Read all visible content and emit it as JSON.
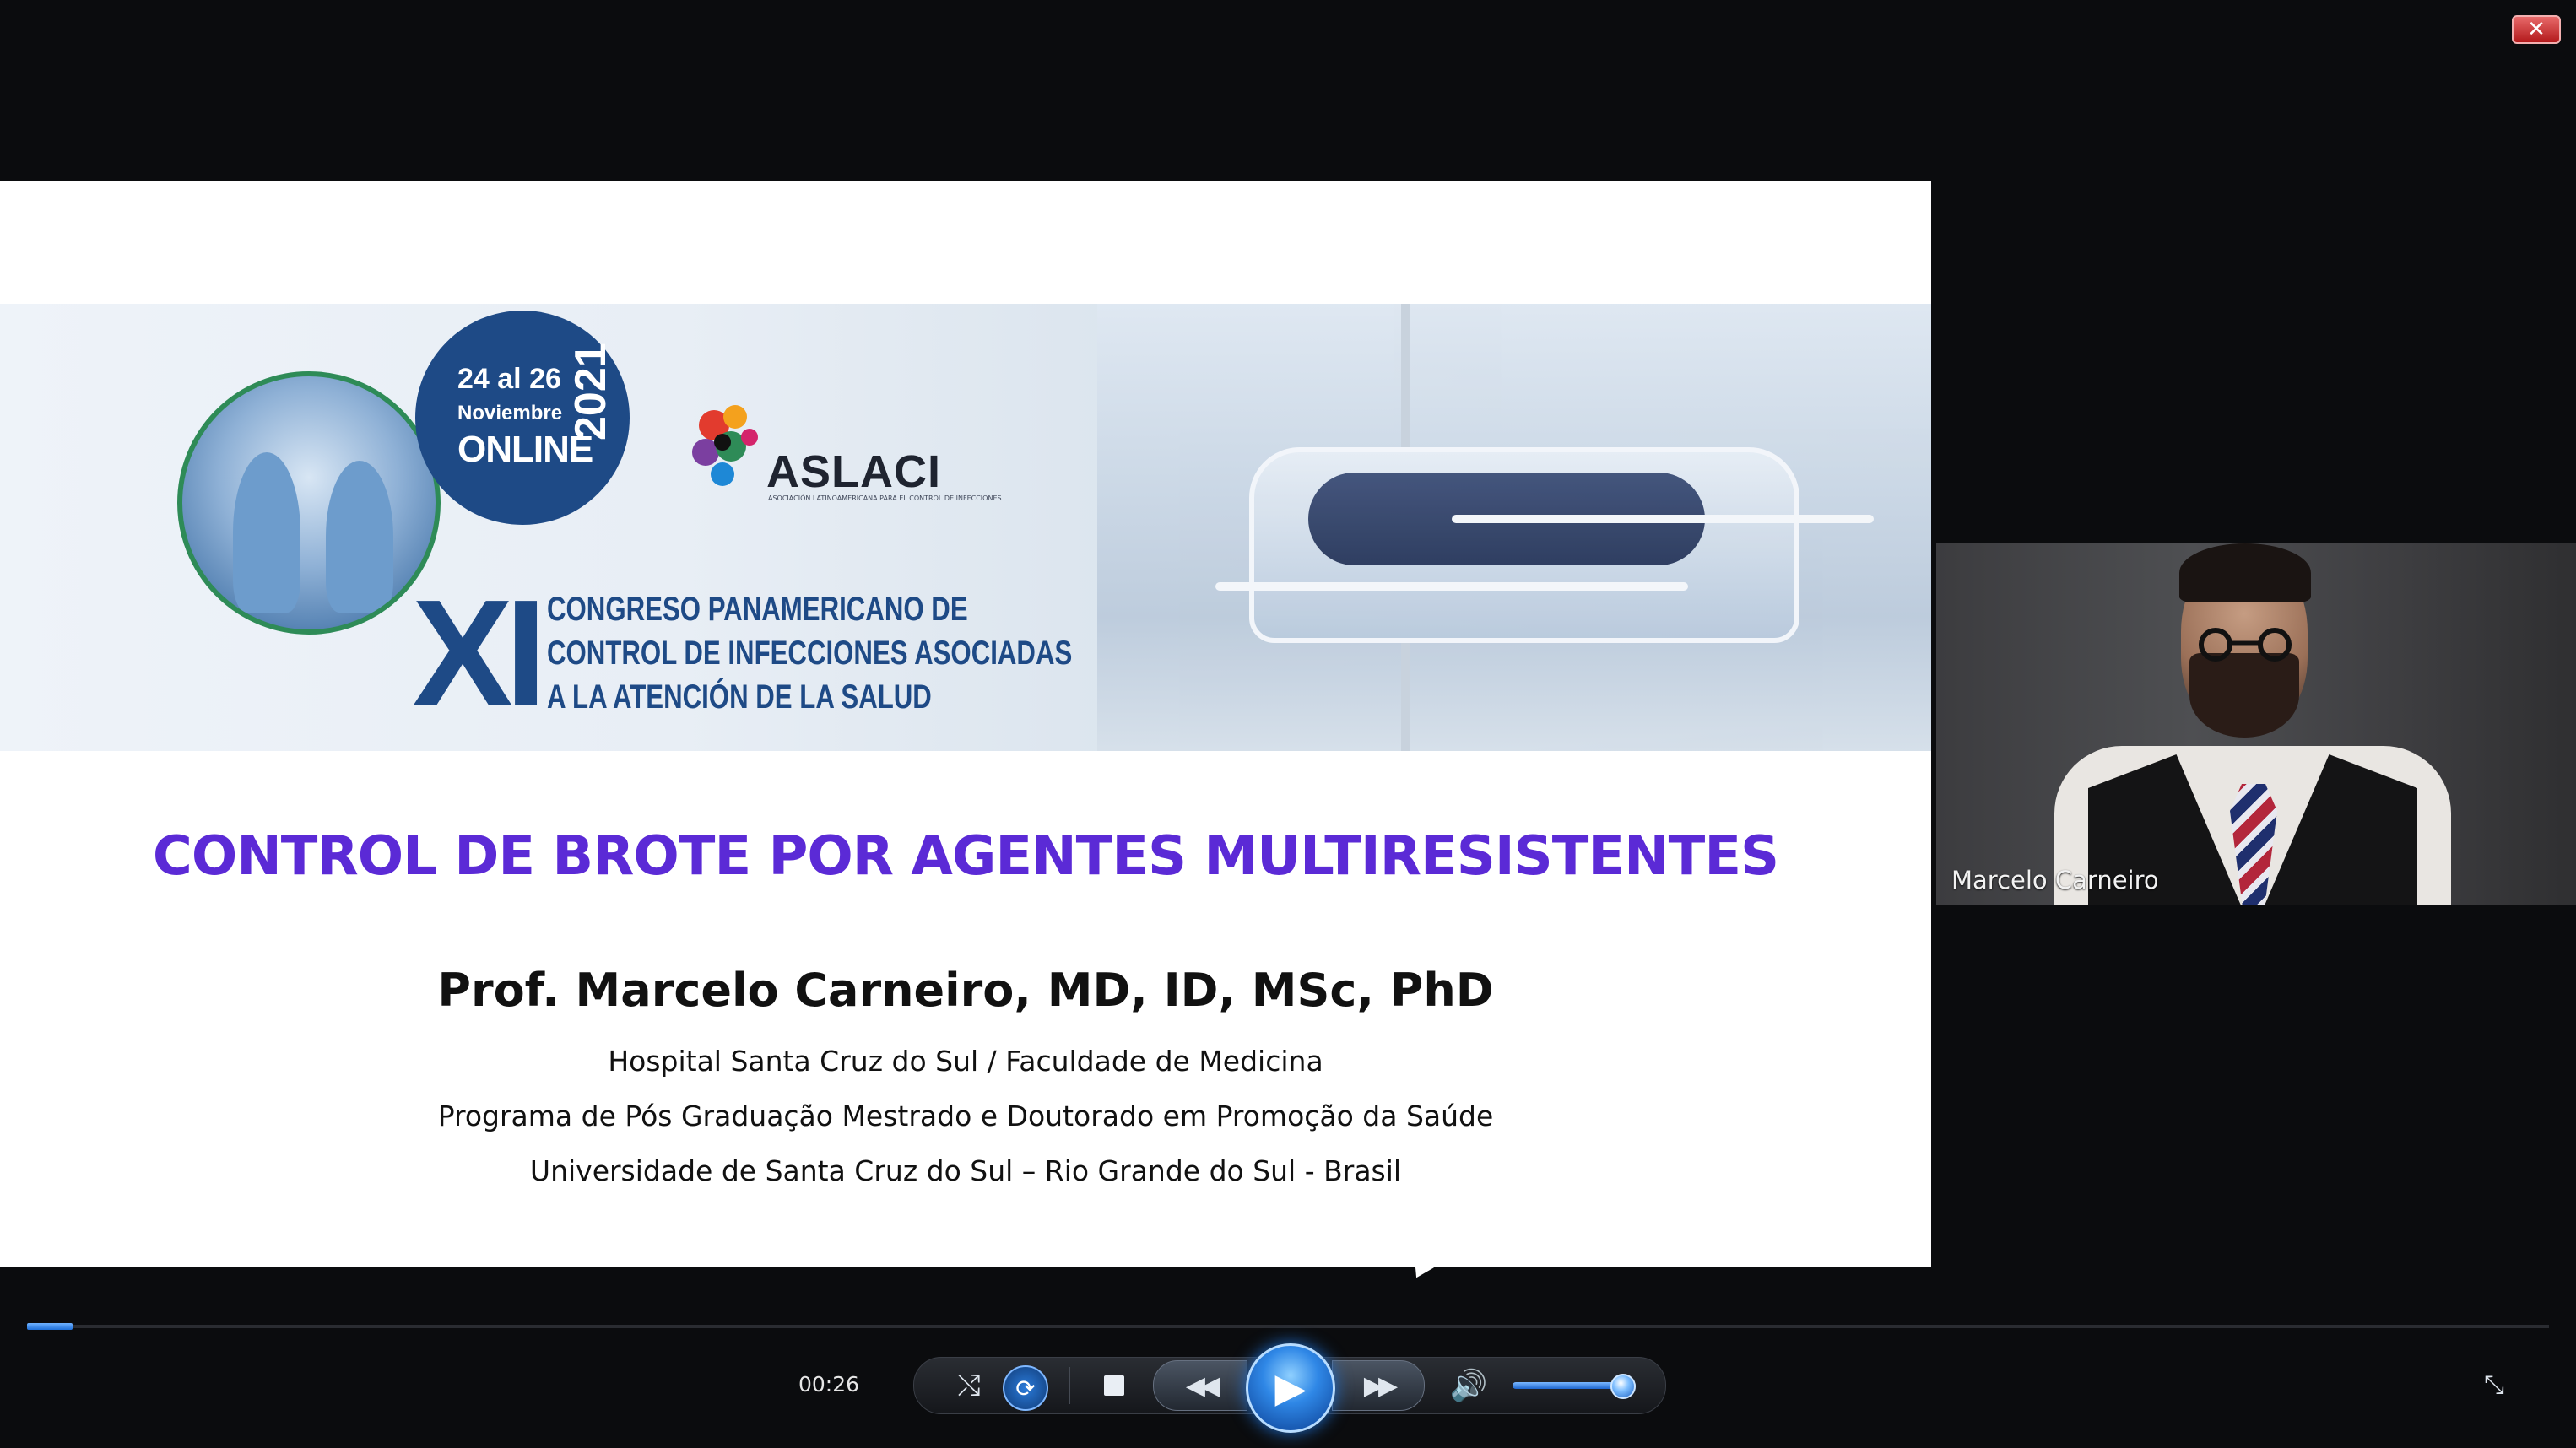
{
  "window": {
    "close_glyph": "✕"
  },
  "slide": {
    "date_line1": "24 al 26",
    "date_line2": "Noviembre",
    "date_line3": "ONLINE",
    "date_year": "2021",
    "org_name": "ASLACI",
    "org_tagline": "ASOCIACIÓN LATINOAMERICANA PARA EL CONTROL DE INFECCIONES",
    "edition": "XI",
    "congress_line1": "CONGRESO PANAMERICANO DE",
    "congress_line2": "CONTROL DE INFECCIONES ASOCIADAS",
    "congress_line3": "A LA ATENCIÓN DE LA SALUD",
    "title": "CONTROL DE BROTE POR AGENTES MULTIRESISTENTES",
    "presenter": "Prof. Marcelo Carneiro, MD, ID, MSc, PhD",
    "affiliations": [
      "Hospital Santa Cruz do Sul / Faculdade de Medicina",
      "Programa de Pós Graduação Mestrado e Doutorado em Promoção da Saúde",
      "Universidade de Santa Cruz do Sul – Rio Grande do Sul - Brasil"
    ],
    "title_color": "#5b2ad6",
    "brand_color": "#1e4a86"
  },
  "webcam": {
    "participant_name": "Marcelo Carneiro"
  },
  "player": {
    "time": "00:26",
    "progress_fraction": 0.018,
    "volume_fraction": 0.9,
    "icons": {
      "shuffle": "⤭",
      "repeat": "⟳",
      "prev": "◀◀",
      "play": "▶",
      "next": "▶▶",
      "volume": "🔊",
      "mini": "⤡"
    }
  }
}
